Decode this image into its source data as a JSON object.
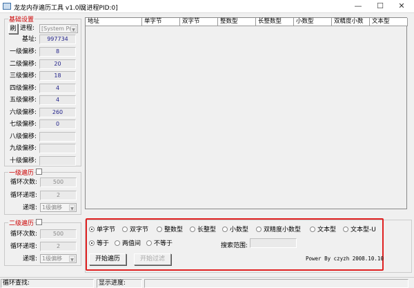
{
  "window": {
    "title": "龙龙内存遍历工具 v1.0版",
    "pid": "[进程PID:0]",
    "minimize": "—",
    "maximize": "☐",
    "close": "✕"
  },
  "basic": {
    "legend": "基础设置",
    "refresh": "刷",
    "process_label": "进程:",
    "process_value": "[System Pr",
    "base_label": "基址:",
    "base_value": "997734",
    "offsets": [
      {
        "label": "一级偏移:",
        "value": "8"
      },
      {
        "label": "二级偏移:",
        "value": "20"
      },
      {
        "label": "三级偏移:",
        "value": "18"
      },
      {
        "label": "四级偏移:",
        "value": "4"
      },
      {
        "label": "五级偏移:",
        "value": "4"
      },
      {
        "label": "六级偏移:",
        "value": "260"
      },
      {
        "label": "七级偏移:",
        "value": "0"
      },
      {
        "label": "八级偏移:",
        "value": ""
      },
      {
        "label": "九级偏移:",
        "value": ""
      },
      {
        "label": "十级偏移:",
        "value": ""
      }
    ]
  },
  "loop1": {
    "legend": "一级遍历",
    "count_label": "循环次数:",
    "count": "500",
    "inc_label": "循环递增:",
    "inc": "2",
    "by_label": "递增:",
    "by": "1级偏移"
  },
  "loop2": {
    "legend": "二级遍历",
    "count_label": "循环次数:",
    "count": "500",
    "inc_label": "循环递增:",
    "inc": "2",
    "by_label": "递增:",
    "by": "1级偏移"
  },
  "table": {
    "columns": [
      "地址",
      "单字节",
      "双字节",
      "整数型",
      "长整数型",
      "小数型",
      "双精度小数",
      "文本型"
    ]
  },
  "types": [
    "单字节",
    "双字节",
    "整数型",
    "长整型",
    "小数型",
    "双精度小数型",
    "文本型",
    "文本型-U"
  ],
  "compare": [
    "等于",
    "两值间",
    "不等于"
  ],
  "range_label": "搜索范围:",
  "buttons": {
    "start": "开始遍历",
    "filter": "开始过滤"
  },
  "power": "Power By czyzh 2008.10.10",
  "status": {
    "loop_find": "循环查找:",
    "progress": "显示进度:"
  }
}
